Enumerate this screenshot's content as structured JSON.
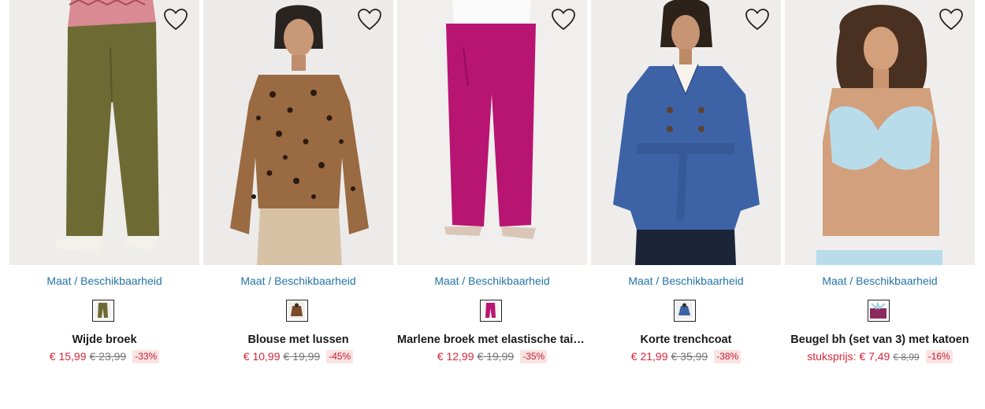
{
  "products": [
    {
      "size_link": "Maat / Beschikbaarheid",
      "name": "Wijde broek",
      "price_prefix": "",
      "price_new": "€ 15,99",
      "price_old": "€ 23,99",
      "discount": "-33%",
      "swatch_color": "#6e6a34"
    },
    {
      "size_link": "Maat / Beschikbaarheid",
      "name": "Blouse met lussen",
      "price_prefix": "",
      "price_new": "€ 10,99",
      "price_old": "€ 19,99",
      "discount": "-45%",
      "swatch_color": "#7a4a2b"
    },
    {
      "size_link": "Maat / Beschikbaarheid",
      "name": "Marlene broek met elastische taille...",
      "price_prefix": "",
      "price_new": "€ 12,99",
      "price_old": "€ 19,99",
      "discount": "-35%",
      "swatch_color": "#b81572"
    },
    {
      "size_link": "Maat / Beschikbaarheid",
      "name": "Korte trenchcoat",
      "price_prefix": "",
      "price_new": "€ 21,99",
      "price_old": "€ 35,99",
      "discount": "-38%",
      "swatch_color": "#3d63a6"
    },
    {
      "size_link": "Maat / Beschikbaarheid",
      "name": "Beugel bh (set van 3) met katoen",
      "price_prefix": "stuksprijs: ",
      "price_new": "€ 7,49",
      "price_old": "€ 8,99",
      "discount": "-16%",
      "swatch_color": "#8a2a5e"
    }
  ]
}
